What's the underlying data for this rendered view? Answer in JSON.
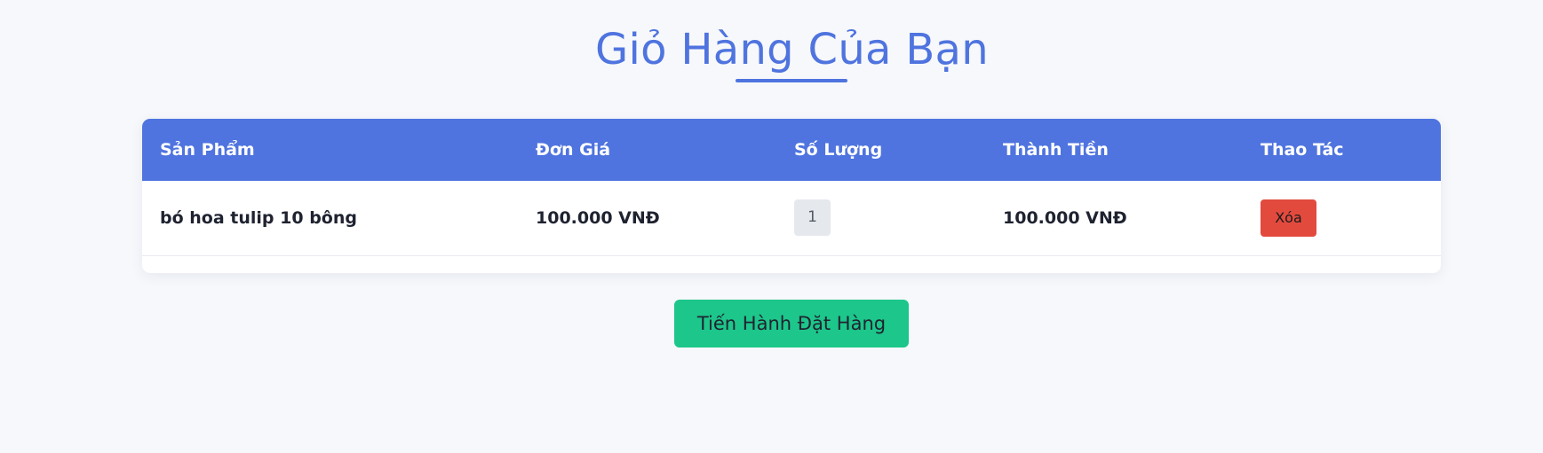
{
  "page": {
    "title": "Giỏ Hàng Của Bạn"
  },
  "cart": {
    "headers": {
      "product": "Sản Phẩm",
      "unit_price": "Đơn Giá",
      "quantity": "Số Lượng",
      "subtotal": "Thành Tiền",
      "actions": "Thao Tác"
    },
    "items": [
      {
        "product": "bó hoa tulip 10 bông",
        "unit_price": "100.000 VNĐ",
        "quantity": "1",
        "subtotal": "100.000 VNĐ",
        "delete_label": "Xóa"
      }
    ]
  },
  "checkout": {
    "button_label": "Tiến Hành Đặt Hàng"
  },
  "colors": {
    "primary": "#4f74df",
    "danger": "#e34a3e",
    "success": "#1dc68a",
    "background": "#f7f8fb"
  }
}
